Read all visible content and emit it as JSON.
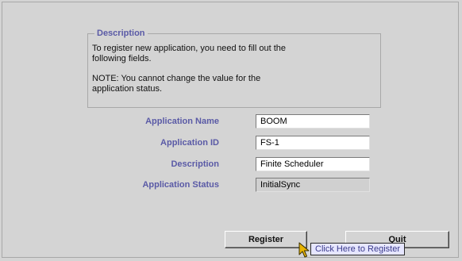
{
  "description": {
    "legend": "Description",
    "paragraph1": "To register new application, you need to fill out the\nfollowing fields.",
    "paragraph2": "NOTE: You cannot change the value for the\napplication status."
  },
  "fields": [
    {
      "label": "Application Name",
      "value": "BOOM"
    },
    {
      "label": "Application ID",
      "value": "FS-1"
    },
    {
      "label": "Description",
      "value": "Finite Scheduler"
    },
    {
      "label": "Application Status",
      "value": "InitialSync"
    }
  ],
  "buttons": {
    "register_label": "Register",
    "quit_label": "Quit"
  },
  "tooltip": {
    "text": "Click Here to Register"
  },
  "icons": {
    "cursor": "arrow-cursor-icon"
  },
  "colors": {
    "label": "#5a5aa6",
    "background": "#d4d4d4",
    "tooltip_bg": "#e6e6ff",
    "cursor": "#e8b400"
  }
}
